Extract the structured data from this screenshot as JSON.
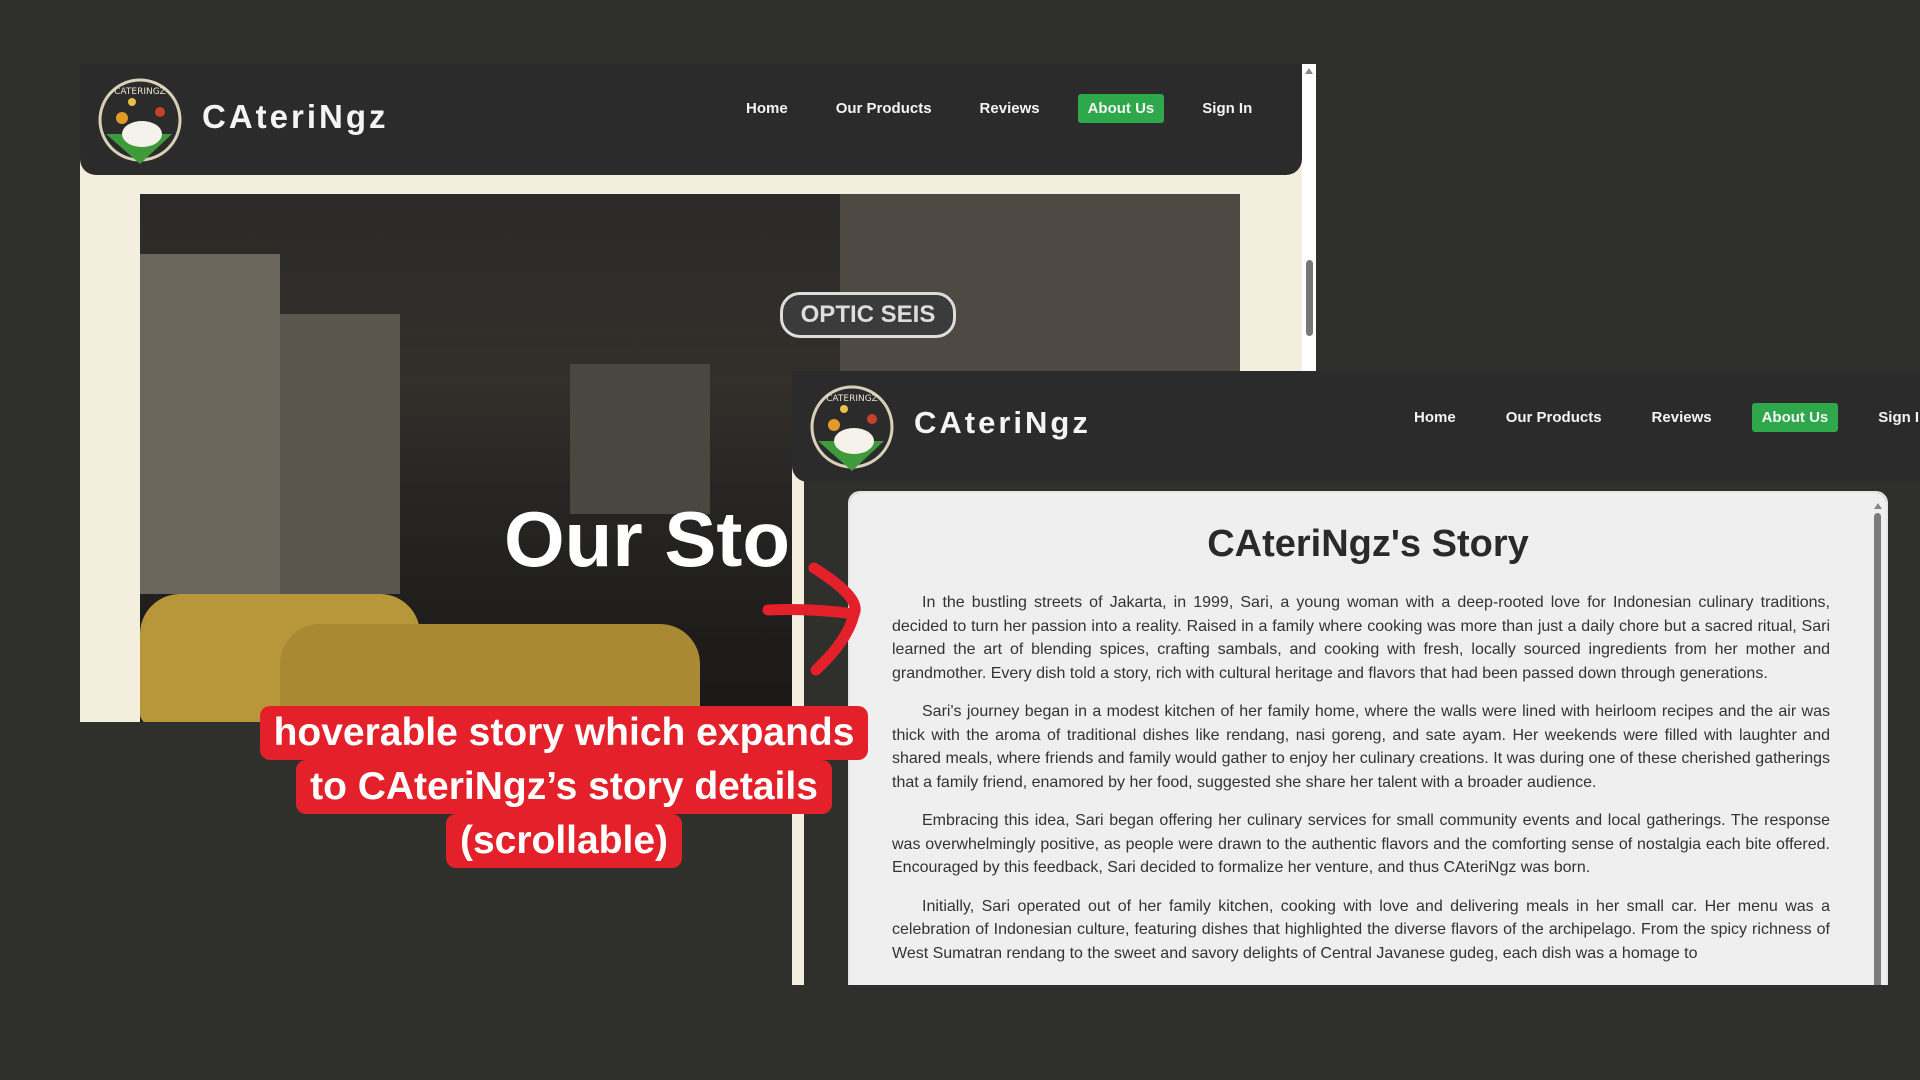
{
  "brand": {
    "name": "CAteriNgz",
    "logo_text": "CATERINGZ"
  },
  "nav": {
    "items": [
      {
        "label": "Home",
        "active": false
      },
      {
        "label": "Our Products",
        "active": false
      },
      {
        "label": "Reviews",
        "active": false
      },
      {
        "label": "About Us",
        "active": true
      },
      {
        "label": "Sign In",
        "active": false
      }
    ]
  },
  "hero": {
    "title": "Our Sto",
    "sign_text": "OPTIC SEIS"
  },
  "story": {
    "title": "CAteriNgz's Story",
    "paragraphs": [
      "In the bustling streets of Jakarta, in 1999, Sari, a young woman with a deep-rooted love for Indonesian culinary traditions, decided to turn her passion into a reality. Raised in a family where cooking was more than just a daily chore but a sacred ritual, Sari learned the art of blending spices, crafting sambals, and cooking with fresh, locally sourced ingredients from her mother and grandmother. Every dish told a story, rich with cultural heritage and flavors that had been passed down through generations.",
      "Sari's journey began in a modest kitchen of her family home, where the walls were lined with heirloom recipes and the air was thick with the aroma of traditional dishes like rendang, nasi goreng, and sate ayam. Her weekends were filled with laughter and shared meals, where friends and family would gather to enjoy her culinary creations. It was during one of these cherished gatherings that a family friend, enamored by her food, suggested she share her talent with a broader audience.",
      "Embracing this idea, Sari began offering her culinary services for small community events and local gatherings. The response was overwhelmingly positive, as people were drawn to the authentic flavors and the comforting sense of nostalgia each bite offered. Encouraged by this feedback, Sari decided to formalize her venture, and thus CAteriNgz was born.",
      "Initially, Sari operated out of her family kitchen, cooking with love and delivering meals in her small car. Her menu was a celebration of Indonesian culture, featuring dishes that highlighted the diverse flavors of the archipelago. From the spicy richness of West Sumatran rendang to the sweet and savory delights of Central Javanese gudeg, each dish was a homage to"
    ]
  },
  "annotation": {
    "lines": [
      "hoverable story which expands",
      "to CAteriNgz’s story details",
      "(scrollable)"
    ],
    "color": "#e4202a"
  },
  "colors": {
    "background": "#2f302c",
    "navbar": "#2b2b2b",
    "active_nav": "#2ea84a"
  }
}
